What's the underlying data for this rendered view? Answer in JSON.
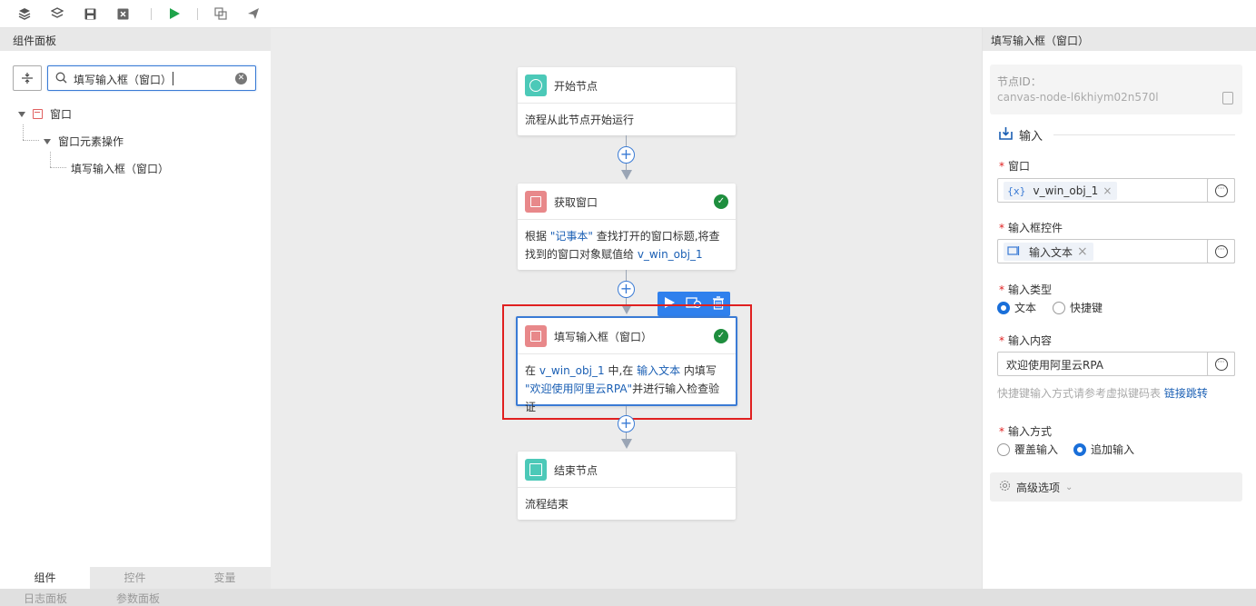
{
  "toolbar": {
    "icons": [
      "layers-icon",
      "layers-alt-icon",
      "save-icon",
      "close-box-icon",
      "play-icon",
      "copy-window-icon",
      "send-icon"
    ]
  },
  "left_panel": {
    "title": "组件面板",
    "search": {
      "value": "填写输入框（窗口）"
    },
    "tree": [
      {
        "label": "窗口",
        "level": 0
      },
      {
        "label": "窗口元素操作",
        "level": 1
      },
      {
        "label": "填写输入框（窗口）",
        "level": 2
      }
    ],
    "tabs": [
      "组件",
      "控件",
      "变量"
    ]
  },
  "status_bar": {
    "items": [
      "日志面板",
      "参数面板"
    ]
  },
  "canvas": {
    "start": {
      "title": "开始节点",
      "body": "流程从此节点开始运行"
    },
    "get_window": {
      "title": "获取窗口",
      "body_parts": [
        "根据 ",
        "\"记事本\"",
        " 查找打开的窗口标题,将查找到的窗口对象赋值给 ",
        "v_win_obj_1"
      ]
    },
    "fill_input": {
      "title": "填写输入框（窗口）",
      "body_parts": [
        "在 ",
        "v_win_obj_1",
        " 中,在 ",
        "输入文本",
        " 内填写 ",
        "\"欢迎使用阿里云RPA\"",
        "并进行输入检查验证"
      ]
    },
    "end": {
      "title": "结束节点",
      "body": "流程结束"
    }
  },
  "right_panel": {
    "title": "填写输入框（窗口）",
    "node_id_label": "节点ID：",
    "node_id": "canvas-node-l6khiym02n570l",
    "section": "输入",
    "window_label": "窗口",
    "window_var_icon": "{x}",
    "window_value": "v_win_obj_1",
    "control_label": "输入框控件",
    "control_value": "输入文本",
    "type_label": "输入类型",
    "type_options": [
      "文本",
      "快捷键"
    ],
    "type_selected": "文本",
    "content_label": "输入内容",
    "content_value": "欢迎使用阿里云RPA",
    "hint_text": "快捷键输入方式请参考虚拟键码表",
    "hint_link": "链接跳转",
    "mode_label": "输入方式",
    "mode_options": [
      "覆盖输入",
      "追加输入"
    ],
    "mode_selected": "追加输入",
    "advanced": "高级选项"
  },
  "colors": {
    "accent": "#1a6fd9",
    "start_node": "#4cc9b8",
    "window_node": "#e8888a",
    "success": "#1e8e3e",
    "highlight_box": "#e02020"
  }
}
